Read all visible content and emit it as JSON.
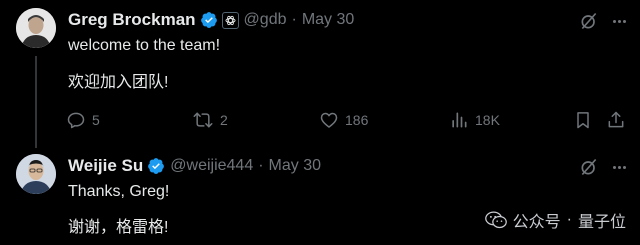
{
  "tweets": [
    {
      "author_name": "Greg Brockman",
      "handle": "@gdb",
      "separator": "·",
      "date": "May 30",
      "lines": [
        "welcome to the team!",
        "欢迎加入团队!"
      ],
      "replies": "5",
      "retweets": "2",
      "likes": "186",
      "views": "18K",
      "icons": [
        "verified-badge-icon",
        "affiliation-logo-icon",
        "grok-icon",
        "more-icon",
        "reply-icon",
        "retweet-icon",
        "like-icon",
        "views-icon",
        "bookmark-icon",
        "share-icon"
      ]
    },
    {
      "author_name": "Weijie Su",
      "handle": "@weijie444",
      "separator": "·",
      "date": "May 30",
      "lines": [
        "Thanks, Greg!",
        "谢谢，格雷格!"
      ],
      "icons": [
        "verified-badge-icon",
        "grok-icon",
        "more-icon"
      ]
    }
  ],
  "watermark": {
    "channel": "公众号",
    "separator": "·",
    "brand": "量子位",
    "icon": "wechat-icon"
  },
  "colors": {
    "background": "#000000",
    "text": "#e7e9ea",
    "muted": "#71767b",
    "verified": "#1d9bf0",
    "thread_line": "#333639"
  }
}
